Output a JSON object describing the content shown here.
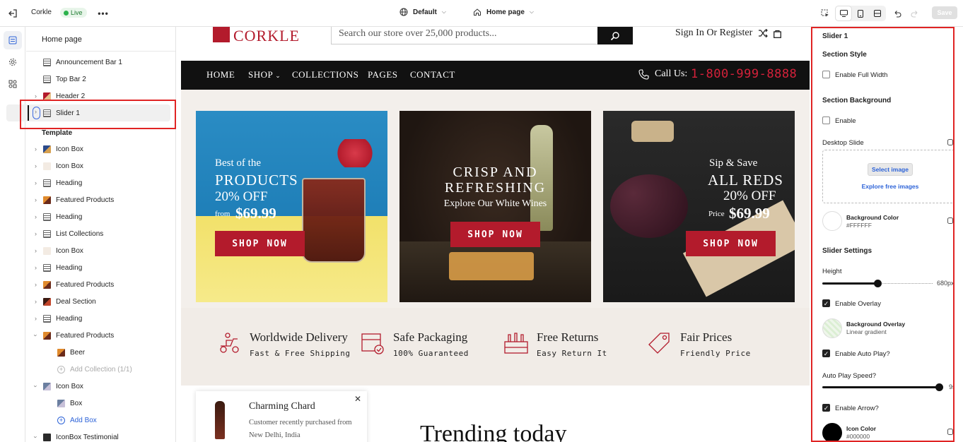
{
  "topbar": {
    "app_name": "Corkle",
    "live_label": "Live",
    "template_select": "Default",
    "page_select": "Home page",
    "save_label": "Save"
  },
  "layers": {
    "title": "Home page",
    "header_items": [
      {
        "label": "Announcement Bar 1"
      },
      {
        "label": "Top Bar 2"
      },
      {
        "label": "Header 2"
      },
      {
        "label": "Slider 1"
      }
    ],
    "template_label": "Template",
    "template_items": [
      {
        "label": "Icon Box"
      },
      {
        "label": "Icon Box"
      },
      {
        "label": "Heading"
      },
      {
        "label": "Featured Products"
      },
      {
        "label": "Heading"
      },
      {
        "label": "List Collections"
      },
      {
        "label": "Icon Box"
      },
      {
        "label": "Heading"
      },
      {
        "label": "Featured Products"
      },
      {
        "label": "Deal Section"
      },
      {
        "label": "Heading"
      },
      {
        "label": "Featured Products"
      },
      {
        "label": "Beer"
      },
      {
        "label": "Add Collection (1/1)"
      },
      {
        "label": "Icon Box"
      },
      {
        "label": "Box"
      },
      {
        "label": "Add Box"
      },
      {
        "label": "IconBox Testimonial"
      }
    ]
  },
  "preview": {
    "logo": "CORKLE",
    "search_placeholder": "Search our store over 25,000 products...",
    "sign_in": "Sign In Or Register",
    "nav": [
      "HOME",
      "SHOP",
      "COLLECTIONS",
      "PAGES",
      "CONTACT"
    ],
    "call_label": "Call Us:",
    "call_number": "1-800-999-8888",
    "banners": [
      {
        "line1": "Best of the",
        "line2": "PRODUCTS",
        "line3": "20% OFF",
        "from": "from",
        "price": "$69.99",
        "button": "SHOP NOW"
      },
      {
        "line1": "CRISP AND",
        "line2": "REFRESHING",
        "line3": "Explore Our White Wines",
        "button": "SHOP NOW"
      },
      {
        "line1": "Sip & Save",
        "line2": "ALL REDS",
        "line3": "20% OFF",
        "from": "Price",
        "price": "$69.99",
        "button": "SHOP NOW"
      }
    ],
    "features": [
      {
        "title": "Worldwide Delivery",
        "sub": "Fast & Free Shipping"
      },
      {
        "title": "Safe Packaging",
        "sub": "100% Guaranteed"
      },
      {
        "title": "Free Returns",
        "sub": "Easy Return It"
      },
      {
        "title": "Fair Prices",
        "sub": "Friendly Price"
      }
    ],
    "popup": {
      "title": "Charming Chard",
      "text": "Customer recently purchased from New Delhi, India"
    },
    "trending": "Trending today"
  },
  "settings": {
    "title": "Slider 1",
    "section_style": "Section Style",
    "enable_full_width": "Enable Full Width",
    "section_background": "Section Background",
    "enable_label": "Enable",
    "desktop_slide": "Desktop Slide",
    "select_image": "Select image",
    "explore_free": "Explore free images",
    "bg_color_label": "Background Color",
    "bg_color_value": "#FFFFFF",
    "slider_settings": "Slider Settings",
    "height_label": "Height",
    "height_value": "680px",
    "height_fraction": 0.5,
    "enable_overlay": "Enable Overlay",
    "bg_overlay_label": "Background Overlay",
    "bg_overlay_value": "Linear gradient",
    "enable_autoplay": "Enable Auto Play?",
    "autoplay_speed_label": "Auto Play Speed?",
    "autoplay_speed_value": "9s",
    "autoplay_fraction": 1.0,
    "enable_arrow": "Enable Arrow?",
    "icon_color_label": "Icon Color",
    "icon_color_value": "#000000"
  },
  "colors": {
    "accent_red": "#b31b2c",
    "highlight_red": "#e02424",
    "link_blue": "#2d63d8",
    "live_green": "#2bb24c"
  }
}
